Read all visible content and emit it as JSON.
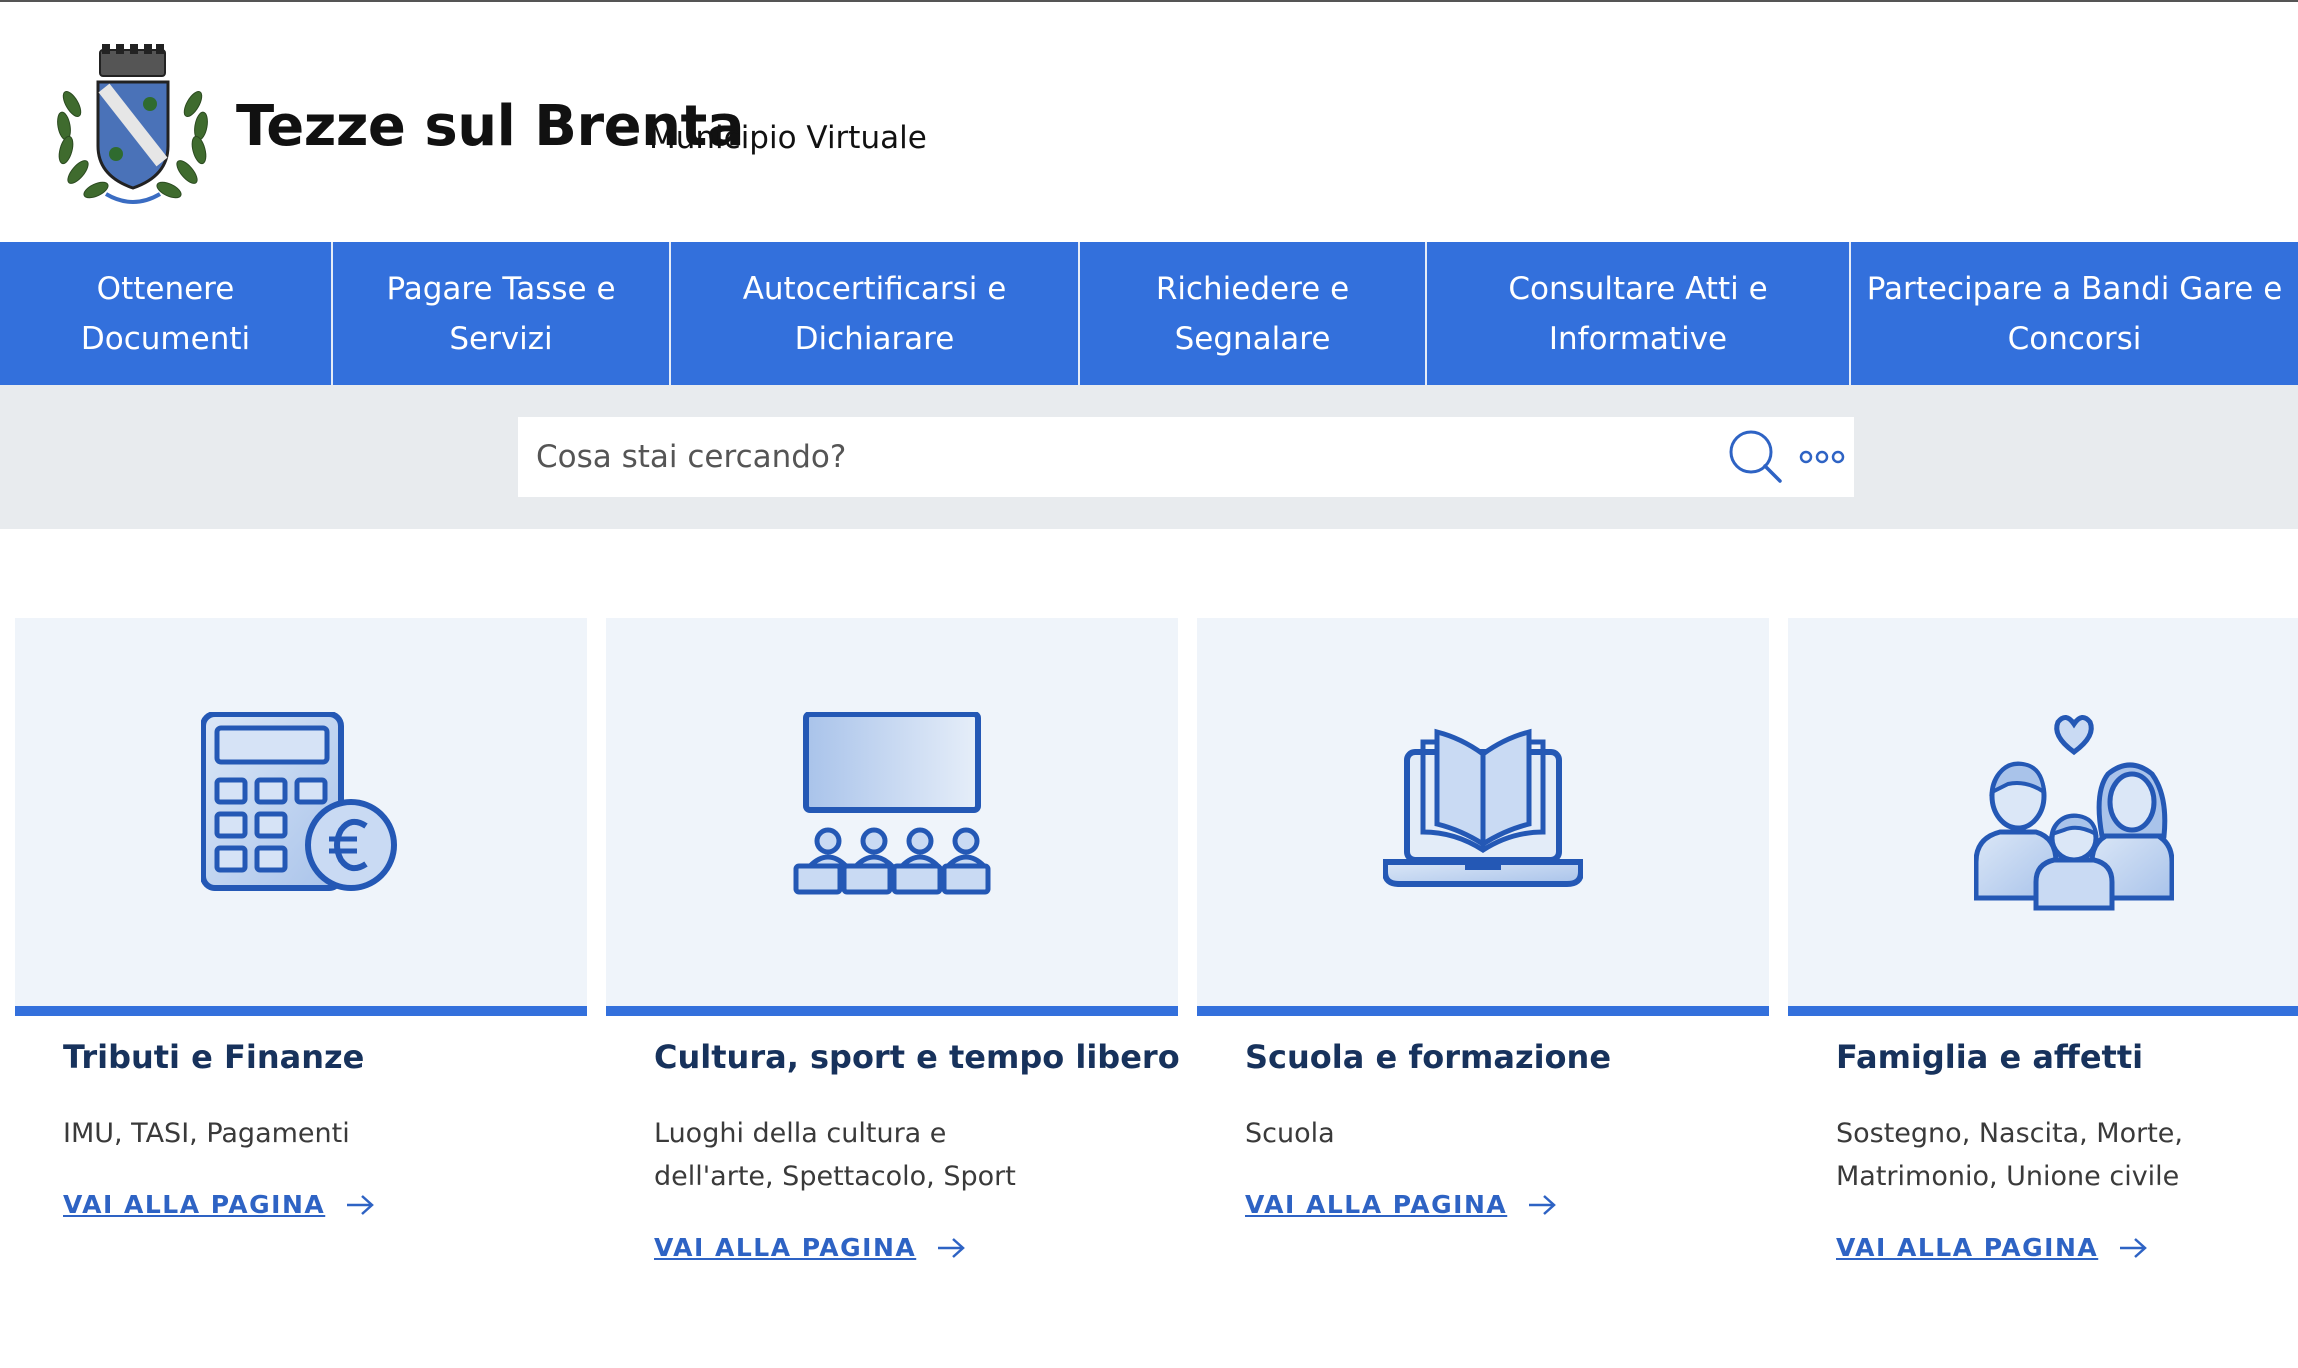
{
  "header": {
    "title": "Tezze sul Brenta",
    "subtitle": "Municipio Virtuale"
  },
  "nav": {
    "items": [
      {
        "line1": "Ottenere",
        "line2": "Documenti"
      },
      {
        "line1": "Pagare Tasse e",
        "line2": "Servizi"
      },
      {
        "line1": "Autocertificarsi e",
        "line2": "Dichiarare"
      },
      {
        "line1": "Richiedere e",
        "line2": "Segnalare"
      },
      {
        "line1": "Consultare Atti e",
        "line2": "Informative"
      },
      {
        "line1": "Partecipare a Bandi Gare e",
        "line2": "Concorsi"
      }
    ]
  },
  "search": {
    "placeholder": "Cosa stai cercando?",
    "search_icon": "search-icon",
    "more_icon": "more-options-icon"
  },
  "cards": [
    {
      "title": "Tributi e Finanze",
      "description": "IMU, TASI, Pagamenti",
      "link": "VAI ALLA PAGINA",
      "icon": "calculator-euro-icon"
    },
    {
      "title": "Cultura, sport e tempo libero",
      "description": "Luoghi della cultura e dell'arte, Spettacolo, Sport",
      "link": "VAI ALLA PAGINA",
      "icon": "cinema-audience-icon"
    },
    {
      "title": "Scuola e formazione",
      "description": "Scuola",
      "link": "VAI ALLA PAGINA",
      "icon": "laptop-book-icon"
    },
    {
      "title": "Famiglia e affetti",
      "description": "Sostegno, Nascita, Morte, Matrimonio, Unione civile",
      "link": "VAI ALLA PAGINA",
      "icon": "family-heart-icon"
    }
  ],
  "colors": {
    "primary": "#3370dc",
    "card_background": "#eff4fa",
    "search_band": "#e8ebee",
    "title_dark": "#17325c",
    "link": "#2e63c4"
  }
}
